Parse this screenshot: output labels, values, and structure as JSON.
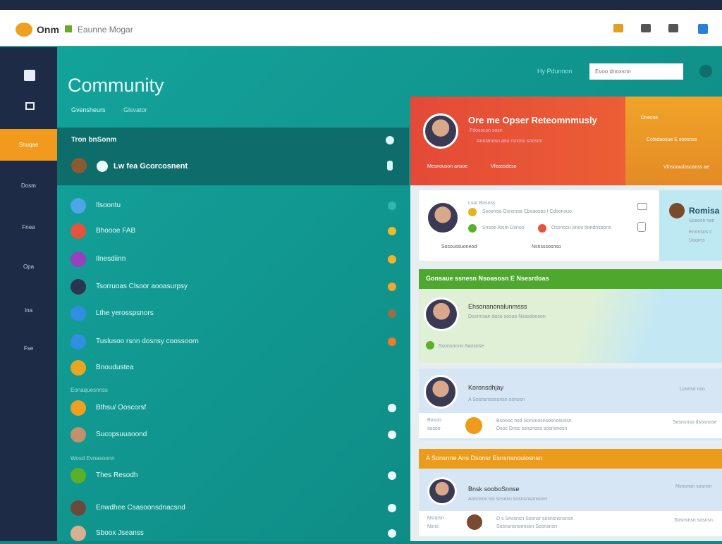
{
  "header": {
    "brand": "Onm",
    "app_name": "Eaunne Mogar",
    "icons": [
      "tag-icon",
      "chat-icon",
      "building-icon",
      "window-icon"
    ]
  },
  "sidebar": {
    "items": [
      {
        "label": "",
        "icon": "dashboard-icon"
      },
      {
        "label": "",
        "icon": "chart-icon"
      },
      {
        "label": "Shuqae",
        "active": true
      },
      {
        "label": "Dosm"
      },
      {
        "label": "Fnea"
      },
      {
        "label": "Opa"
      },
      {
        "label": "Ina"
      },
      {
        "label": "Fse"
      }
    ]
  },
  "page": {
    "title": "Community",
    "breadcrumb": [
      "Gvensheurs",
      "Glsvator"
    ]
  },
  "top_right": {
    "link": "Hy Pdunnon",
    "search_placeholder": "Evoo dnoxsnn"
  },
  "panel": {
    "header": "Tron bnSonm",
    "featured": "Lw fea Gcorcosnent"
  },
  "list": [
    {
      "label": "Ilsoontu",
      "color": "#4aa6e8",
      "dot": "#30b8b0"
    },
    {
      "label": "Bhoooe FAB",
      "color": "#e5533c",
      "dot": "#f2b92a"
    },
    {
      "label": "Ilnesdiinn",
      "color": "#9a3fbf",
      "dot": "#f0b42a"
    },
    {
      "label": "Tsorruoas Clsoor aooasurpsy",
      "color": "#2a3550",
      "dot": "#f0a82a"
    },
    {
      "label": "Lthe yerosspsnors",
      "color": "#2f8fe0",
      "dot": "#9a7040"
    },
    {
      "label": "Tuslusoo rsnn dosnsy coossoorn",
      "color": "#2f8fe0",
      "dot": "#ee7a2a"
    },
    {
      "label": "Bnoudustea",
      "color": "#e9a620",
      "dot": ""
    }
  ],
  "section1": "Eonaquesnnss",
  "list2": [
    {
      "label": "Bthsu/ Ooscorsf",
      "color": "#f0a020"
    },
    {
      "label": "Sucopsuuaoond",
      "color": "#c09070"
    }
  ],
  "section2": "Wosd Evnasoonn",
  "list3": [
    {
      "label": "Thes Resodh",
      "color": "#5bb02a"
    },
    {
      "label": "Enwdhee Csasoonsdnacsnd",
      "color": "#6a4a3a"
    },
    {
      "label": "Sboox Jseanss",
      "color": "#d8b090"
    }
  ],
  "red_card": {
    "title": "Ore me Opser Reteomnmusly",
    "sub1": "Fdosscsn sosn",
    "sub2": "Anostnosn aso rsnoss soosnn",
    "footer1": "Mesnouson ansoe",
    "footer2": "Vfeassdeso"
  },
  "orange_card": {
    "line1": "Dnecne",
    "line2": "Cotsdaosue E soosnss",
    "footer": "Vfnsooudoscanss ae"
  },
  "white_card": {
    "name": "Lsor Bosnss",
    "line1": "Ssosnoa Osnsnsa  Cbsaosas i Cdsonsuo",
    "line2": "Snsoe Atsm Dsnoo",
    "line3": "Ossnocu pnou tiondnsbons",
    "footer1": "Sosoussuoneod",
    "footer2": "Nsnsssosnso"
  },
  "blue_card": {
    "name": "Romisa",
    "line1": "Sososn nsn",
    "line2": "Enonsos c",
    "line3": "Uoorns"
  },
  "green_section": {
    "bar": "Gonsaue ssnesn Nsoasosn E Nsesrdoas",
    "name": "Ehsonanonalunmsss",
    "sub": "Dosnnsan daso sosoo Nsasdsoson",
    "footer": "Ssonsoono Saosnse"
  },
  "card3": {
    "name": "Koronsdhjay",
    "sub": "A Sosnsnsosunsn osnosn",
    "row_left1": "Bosoo",
    "row_left2": "sosoo",
    "row_text": "Bsoooc nsd Sonsnosnsosnosussn",
    "row_sub": "Dsoc Dnsc ssnsnoss sosnsnosn",
    "row_right": "Sosnsnso dsosnose",
    "meta": "Losnso nso"
  },
  "orange_section": {
    "bar": "A Sonsnne Ans Dsonsr Esnsnsnoulosnsn",
    "name": "Bnsk sooboSnnse",
    "sub": "Aosnsnu ssi snsosn sosnsnsonsosn",
    "row_left1": "Nsopsn",
    "row_left2": "Nsns",
    "row_text": "D s Snssnsn Sosnsr sosnsnsnsnsn",
    "row_sub": "Sosnsnsnoonssn Sosnsnsn",
    "row_right": "Sosnsnsn sosnsn",
    "meta": "Nsnsnsn sosnsn"
  },
  "colors": {
    "teal": "#0d8a84",
    "navy": "#1e2b47",
    "orange": "#f29a1e",
    "red": "#e44a37",
    "green": "#4ea82e"
  }
}
